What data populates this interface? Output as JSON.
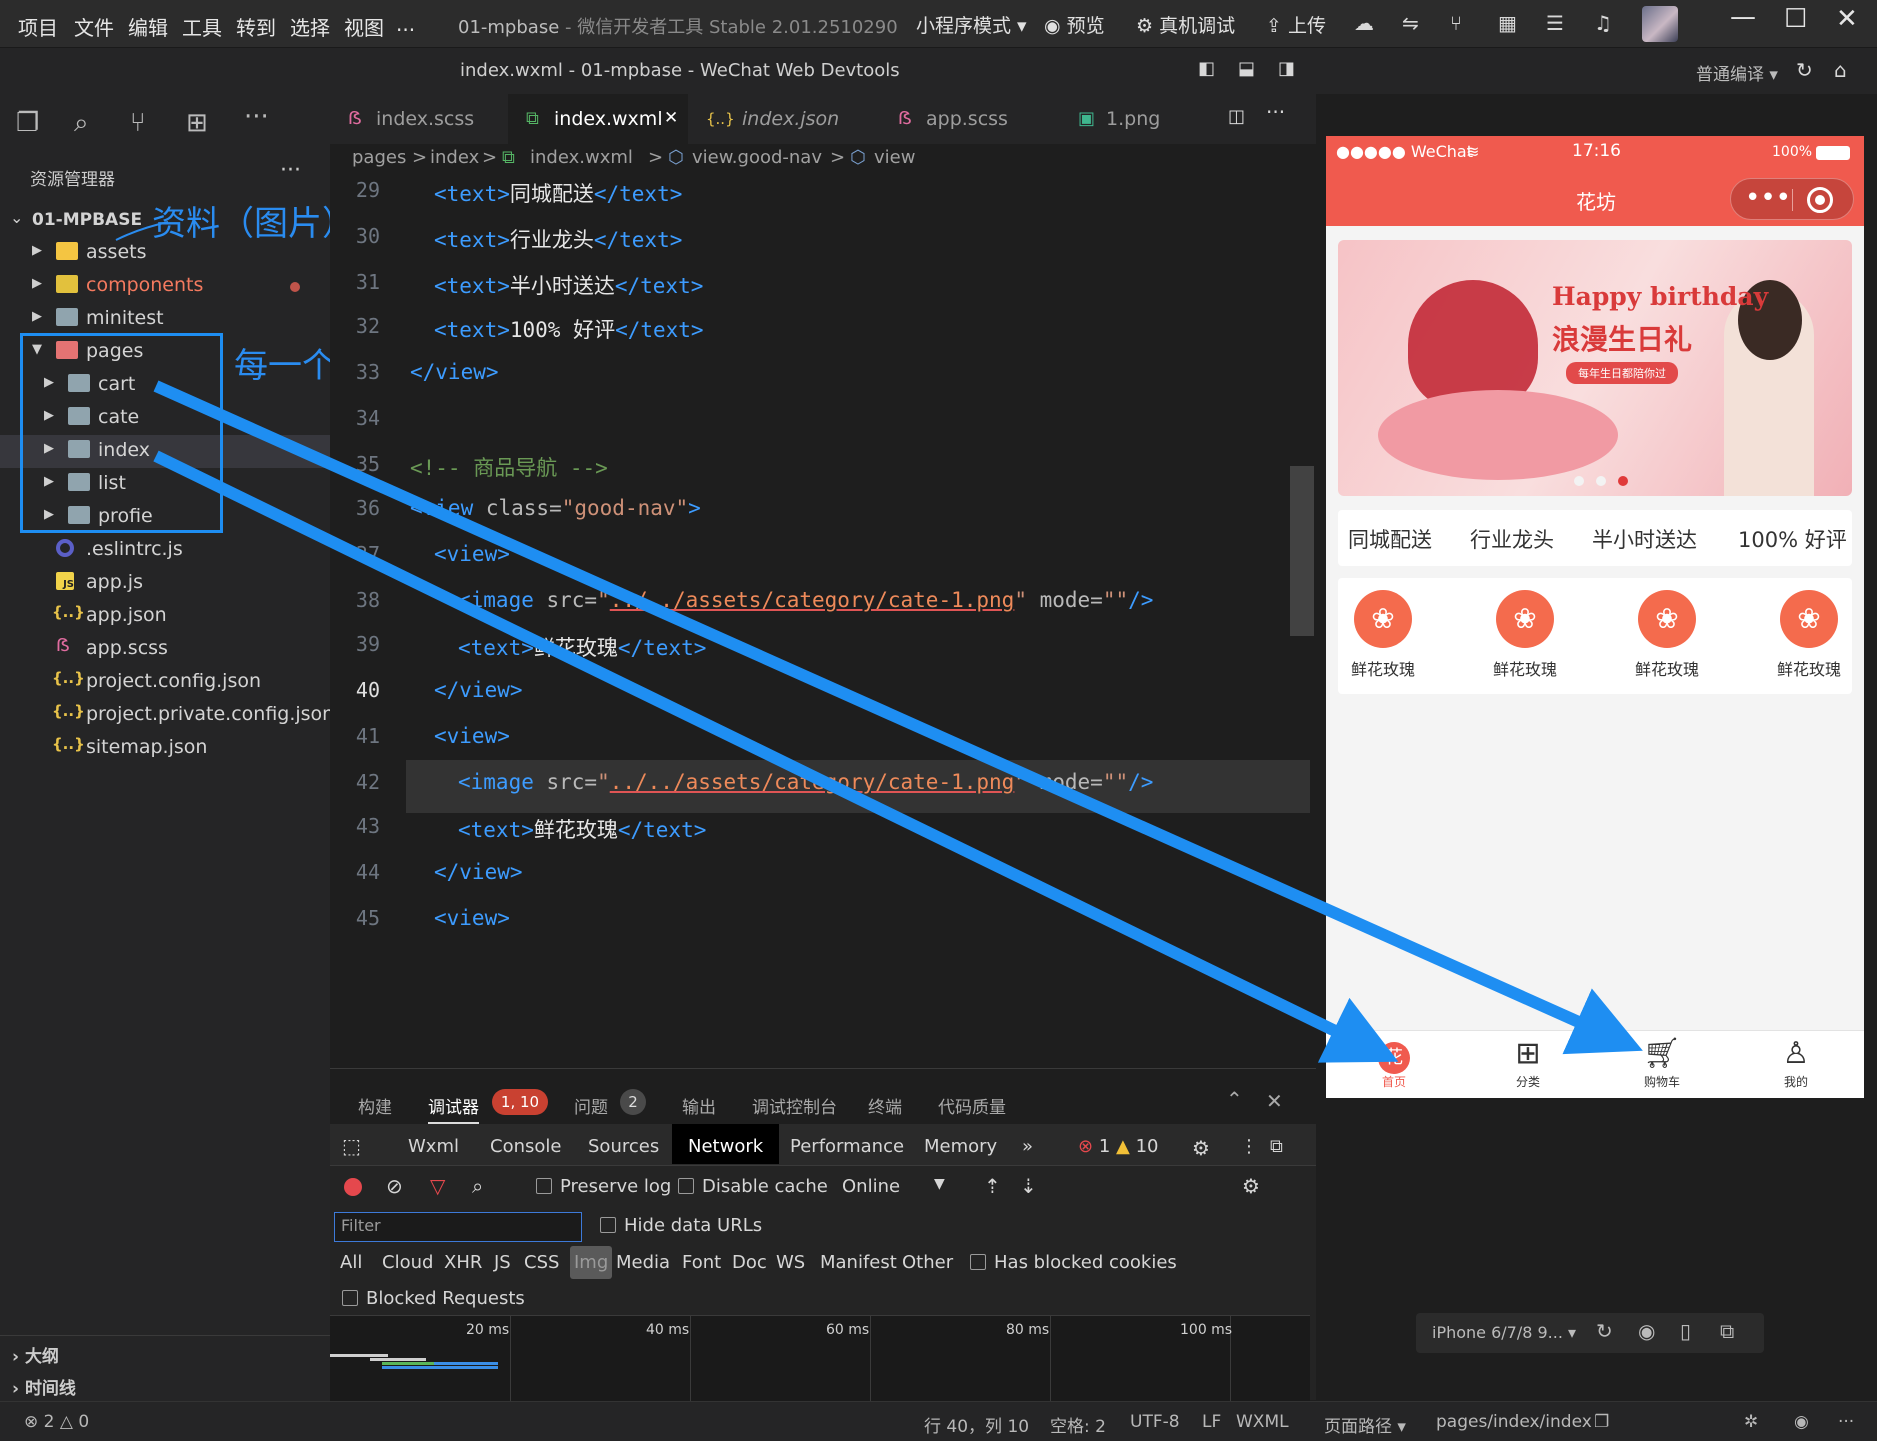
{
  "titlebar": {
    "menu": [
      "项目",
      "文件",
      "编辑",
      "工具",
      "转到",
      "选择",
      "视图",
      "..."
    ],
    "project": "01-mpbase",
    "separator": " - ",
    "app_version": "微信开发者工具 Stable 2.01.2510290",
    "mode": "小程序模式 ▾",
    "preview": "预览",
    "real_debug": "真机调试",
    "upload": "上传"
  },
  "subbar": {
    "window_title": "index.wxml - 01-mpbase - WeChat Web Devtools",
    "compile_mode": "普通编译 ▾"
  },
  "explorer": {
    "title": "资源管理器",
    "more": "···",
    "root": "01-MPBASE",
    "items": [
      {
        "label": "assets"
      },
      {
        "label": "components"
      },
      {
        "label": "minitest"
      },
      {
        "label": "pages"
      },
      {
        "label": "cart"
      },
      {
        "label": "cate"
      },
      {
        "label": "index"
      },
      {
        "label": "list"
      },
      {
        "label": "profie"
      },
      {
        "label": ".eslintrc.js"
      },
      {
        "label": "app.js"
      },
      {
        "label": "app.json"
      },
      {
        "label": "app.scss"
      },
      {
        "label": "project.config.json"
      },
      {
        "label": "project.private.config.json"
      },
      {
        "label": "sitemap.json"
      }
    ],
    "json_glyph": "{..}",
    "js_glyph": "JS",
    "scss_glyph": "ẞ",
    "outline": "大纲",
    "timeline": "时间线"
  },
  "annotations": {
    "assets_note": "资料（图片）",
    "pages_note": "每一个页面"
  },
  "tabs": [
    {
      "label": "index.scss"
    },
    {
      "label": "index.wxml",
      "close": "✕"
    },
    {
      "label": "index.json"
    },
    {
      "label": "app.scss"
    },
    {
      "label": "1.png"
    }
  ],
  "breadcrumb": {
    "seg1": "pages",
    "seg2": "index",
    "seg3": "index.wxml",
    "seg4": "view.good-nav",
    "seg5": "view",
    "sep": ">"
  },
  "code": {
    "line_numbers": [
      "29",
      "30",
      "31",
      "32",
      "33",
      "34",
      "35",
      "36",
      "37",
      "38",
      "39",
      "40",
      "41",
      "42",
      "43",
      "44",
      "45"
    ],
    "open_text": "<text>",
    "close_text": "</text>",
    "t29": "同城配送",
    "t30": "行业龙头",
    "t31": "半小时送达",
    "t32": "100% 好评",
    "close_view": "</view>",
    "comment": "<!-- 商品导航 -->",
    "l36_open": "<view",
    "l36_attr": " class=",
    "l36_val": "\"good-nav\"",
    "l36_end": ">",
    "open_view": "<view>",
    "img_open": "<image",
    "img_src_attr": " src=",
    "img_q": "\"",
    "img_path": "../../assets/category/cate-1.png",
    "img_mode": " mode=",
    "img_mode_val": "\"\"",
    "img_close": "/>",
    "cate_label": "鲜花玫瑰"
  },
  "panel": {
    "tabs": [
      "构建",
      "调试器",
      "问题",
      "输出",
      "调试控制台",
      "终端",
      "代码质量"
    ],
    "debugger_badge": "1, 10",
    "problems_badge": "2"
  },
  "devtools": {
    "tabs": [
      "Wxml",
      "Console",
      "Sources",
      "Network",
      "Performance",
      "Memory"
    ],
    "more": "»",
    "errors": "1",
    "warnings": "10",
    "preserve_log": "Preserve log",
    "disable_cache": "Disable cache",
    "throttle": "Online",
    "filter_placeholder": "Filter",
    "hide_data_urls": "Hide data URLs",
    "types": [
      "All",
      "Cloud",
      "XHR",
      "JS",
      "CSS",
      "Img",
      "Media",
      "Font",
      "Doc",
      "WS",
      "Manifest",
      "Other"
    ],
    "has_blocked_cookies": "Has blocked cookies",
    "blocked_requests": "Blocked Requests",
    "timeline": [
      "20 ms",
      "40 ms",
      "60 ms",
      "80 ms",
      "100 ms"
    ]
  },
  "simulator": {
    "carrier": "●●●●● WeChat",
    "time": "17:16",
    "battery": "100%",
    "nav_title": "花坊",
    "capsule_dots": "•••",
    "banner_title": "Happy birthday",
    "banner_sub": "浪漫生日礼",
    "banner_tag": "每年生日都陪你过",
    "features": [
      "同城配送",
      "行业龙头",
      "半小时送达",
      "100% 好评"
    ],
    "categories": [
      "鲜花玫瑰",
      "鲜花玫瑰",
      "鲜花玫瑰",
      "鲜花玫瑰"
    ],
    "tabbar": [
      "首页",
      "分类",
      "购物车",
      "我的"
    ],
    "home_glyph": "花",
    "device": "iPhone 6/7/8 9... ▾"
  },
  "statusbar": {
    "errors": "2",
    "warnings": "0",
    "position": "行 40，列 10",
    "spaces": "空格: 2",
    "encoding": "UTF-8",
    "eol": "LF",
    "language": "WXML",
    "page_path_label": "页面路径 ▾",
    "page_path": "pages/index/index"
  },
  "colors": {
    "accent_blue": "#1e8ef2",
    "brand_red": "#f05a4e",
    "tab_active": "#f05a4e"
  }
}
